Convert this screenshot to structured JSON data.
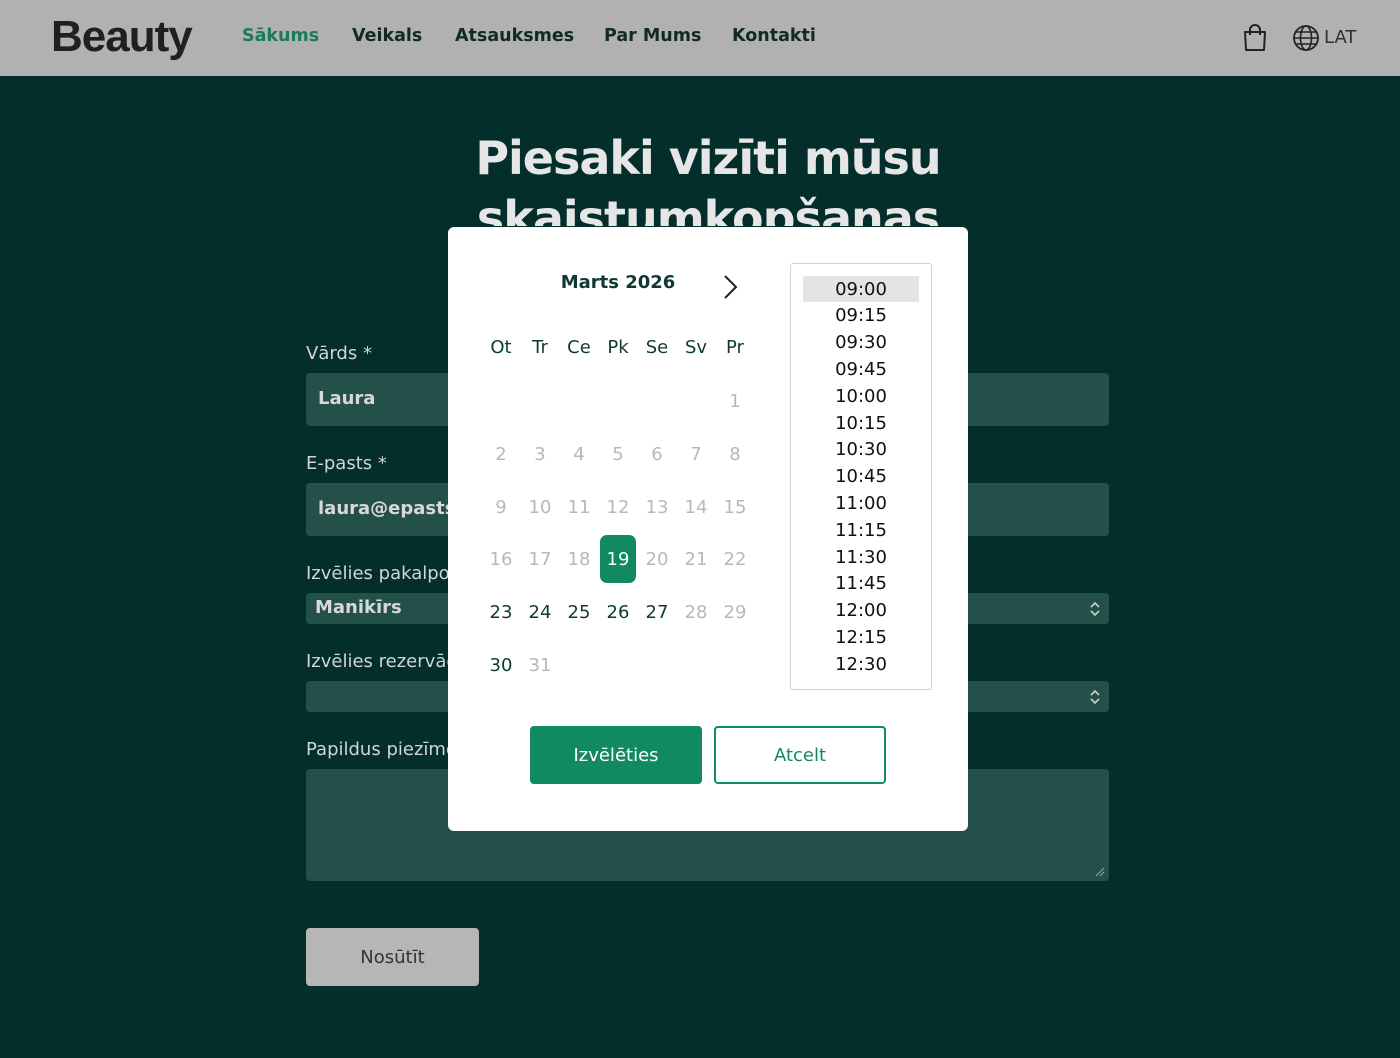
{
  "header": {
    "logo": "Beauty",
    "nav": [
      "Sākums",
      "Veikals",
      "Atsauksmes",
      "Par Mums",
      "Kontakti"
    ],
    "active_nav": "Sākums",
    "language": "LAT"
  },
  "page": {
    "title": "Piesaki vizīti mūsu skaistumkopšanas"
  },
  "form": {
    "name_label": "Vārds *",
    "name_value": "Laura",
    "email_label": "E-pasts *",
    "email_value": "laura@epasts.",
    "service_label": "Izvēlies pakalpoj",
    "service_value": "Manikīrs",
    "reservation_label": "Izvēlies rezervāc",
    "reservation_value": "",
    "notes_label": "Papildus piezīme",
    "submit_label": "Nosūtīt"
  },
  "picker": {
    "month": "Marts 2026",
    "weekdays": [
      "Ot",
      "Tr",
      "Ce",
      "Pk",
      "Se",
      "Sv",
      "Pr"
    ],
    "days": [
      "1",
      "2",
      "3",
      "4",
      "5",
      "6",
      "7",
      "8",
      "9",
      "10",
      "11",
      "12",
      "13",
      "14",
      "15",
      "16",
      "17",
      "18",
      "19",
      "20",
      "21",
      "22",
      "23",
      "24",
      "25",
      "26",
      "27",
      "28",
      "29",
      "30",
      "31"
    ],
    "enabled_days": [
      "19",
      "23",
      "24",
      "25",
      "26",
      "27",
      "30"
    ],
    "selected_day": "19",
    "times": [
      "09:00",
      "09:15",
      "09:30",
      "09:45",
      "10:00",
      "10:15",
      "10:30",
      "10:45",
      "11:00",
      "11:15",
      "11:30",
      "11:45",
      "12:00",
      "12:15",
      "12:30"
    ],
    "selected_time": "09:00",
    "choose_label": "Izvēlēties",
    "cancel_label": "Atcelt"
  },
  "colors": {
    "background": "#032e2b",
    "header": "#b1b1b1",
    "accent": "#118a63",
    "field": "#24504a"
  }
}
